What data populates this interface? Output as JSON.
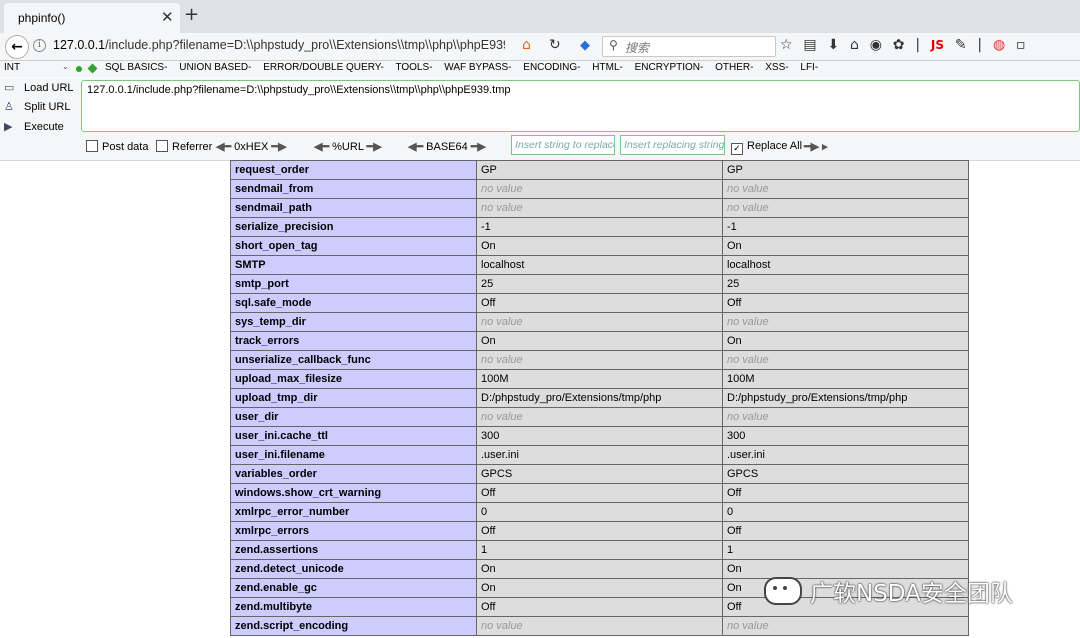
{
  "browser": {
    "tab_title": "phpinfo()",
    "url": "127.0.0.1/include.php?filename=D:\\\\phpstudy_pro\\\\Extensions\\\\tmp\\\\php\\\\phpE939.t\u0000",
    "url_display_host": "127.0.0.1",
    "url_display_path": "/include.php?filename=D:\\\\phpstudy_pro\\\\Extensions\\\\tmp\\\\php\\\\phpE939.tı",
    "search_placeholder": "搜索"
  },
  "hackbar": {
    "select_value": "INT",
    "menu": [
      "SQL BASICS-",
      "UNION BASED-",
      "ERROR/DOUBLE QUERY-",
      "TOOLS-",
      "WAF BYPASS-",
      "ENCODING-",
      "HTML-",
      "ENCRYPTION-",
      "OTHER-",
      "XSS-",
      "LFI-"
    ],
    "load_url": "Load URL",
    "split_url": "Split URL",
    "execute": "Execute",
    "url_value": "127.0.0.1/include.php?filename=D:\\\\phpstudy_pro\\\\Extensions\\\\tmp\\\\php\\\\phpE939.tmp",
    "post_data": "Post data",
    "referrer": "Referrer",
    "hex": "0xHEX",
    "url_enc": "%URL",
    "base64": "BASE64",
    "insert_replace_placeholder": "Insert string to replace",
    "insert_replacing_placeholder": "Insert replacing string",
    "replace_all": "Replace All"
  },
  "rows": [
    [
      "request_order",
      "GP",
      "GP"
    ],
    [
      "sendmail_from",
      "no value",
      "no value"
    ],
    [
      "sendmail_path",
      "no value",
      "no value"
    ],
    [
      "serialize_precision",
      "-1",
      "-1"
    ],
    [
      "short_open_tag",
      "On",
      "On"
    ],
    [
      "SMTP",
      "localhost",
      "localhost"
    ],
    [
      "smtp_port",
      "25",
      "25"
    ],
    [
      "sql.safe_mode",
      "Off",
      "Off"
    ],
    [
      "sys_temp_dir",
      "no value",
      "no value"
    ],
    [
      "track_errors",
      "On",
      "On"
    ],
    [
      "unserialize_callback_func",
      "no value",
      "no value"
    ],
    [
      "upload_max_filesize",
      "100M",
      "100M"
    ],
    [
      "upload_tmp_dir",
      "D:/phpstudy_pro/Extensions/tmp/php",
      "D:/phpstudy_pro/Extensions/tmp/php"
    ],
    [
      "user_dir",
      "no value",
      "no value"
    ],
    [
      "user_ini.cache_ttl",
      "300",
      "300"
    ],
    [
      "user_ini.filename",
      ".user.ini",
      ".user.ini"
    ],
    [
      "variables_order",
      "GPCS",
      "GPCS"
    ],
    [
      "windows.show_crt_warning",
      "Off",
      "Off"
    ],
    [
      "xmlrpc_error_number",
      "0",
      "0"
    ],
    [
      "xmlrpc_errors",
      "Off",
      "Off"
    ],
    [
      "zend.assertions",
      "1",
      "1"
    ],
    [
      "zend.detect_unicode",
      "On",
      "On"
    ],
    [
      "zend.enable_gc",
      "On",
      "On"
    ],
    [
      "zend.multibyte",
      "Off",
      "Off"
    ],
    [
      "zend.script_encoding",
      "no value",
      "no value"
    ]
  ],
  "watermark": "广软NSDA安全团队"
}
